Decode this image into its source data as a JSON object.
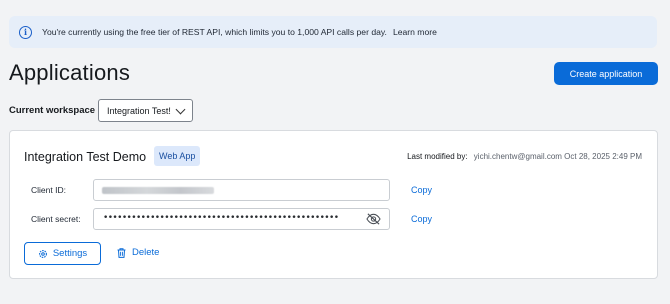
{
  "banner": {
    "icon": "info-icon",
    "message": "You're currently using the free tier of REST API, which limits you to 1,000 API calls per day.",
    "link": "Learn more"
  },
  "header": {
    "title": "Applications",
    "create_button": "Create application"
  },
  "workspace": {
    "label": "Current workspace",
    "selected": "Integration Test!"
  },
  "app": {
    "name": "Integration Test Demo",
    "badge": "Web App",
    "modified_label": "Last modified by:",
    "modified_value": "yichi.chentw@gmail.com Oct 28, 2025 2:49 PM",
    "client_id_label": "Client ID:",
    "client_secret_label": "Client secret:",
    "client_secret_masked": "••••••••••••••••••••••••••••••••••••••••••••••••••",
    "copy_label": "Copy",
    "settings_label": "Settings",
    "delete_label": "Delete",
    "accent_color": "#0a6bd8"
  }
}
